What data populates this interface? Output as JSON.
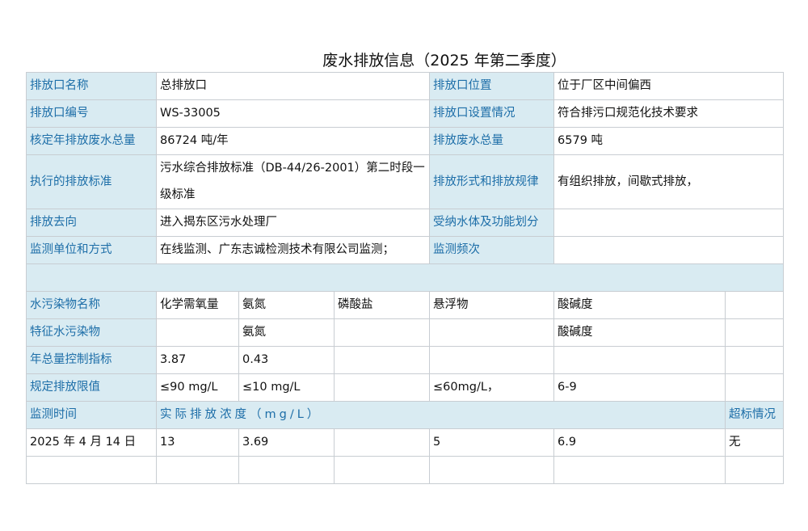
{
  "title": "废水排放信息（2025 年第二季度）",
  "info": {
    "outlet_name_label": "排放口名称",
    "outlet_name": "总排放口",
    "outlet_location_label": "排放口位置",
    "outlet_location": "位于厂区中间偏西",
    "outlet_code_label": "排放口编号",
    "outlet_code": "WS-33005",
    "outlet_setup_label": "排放口设置情况",
    "outlet_setup": "符合排污口规范化技术要求",
    "annual_total_label": "核定年排放废水总量",
    "annual_total": "86724 吨/年",
    "discharge_total_label": "排放废水总量",
    "discharge_total": "6579 吨",
    "standard_label": "执行的排放标准",
    "standard": "污水综合排放标准（DB-44/26-2001）第二时段一级标准",
    "discharge_form_label": "排放形式和排放规律",
    "discharge_form": "有组织排放，间歇式排放，",
    "destination_label": "排放去向",
    "destination": "进入揭东区污水处理厂",
    "receiving_label": "受纳水体及功能划分",
    "receiving": "",
    "monitor_unit_label": "监测单位和方式",
    "monitor_unit": "在线监测、广东志诚检测技术有限公司监测；",
    "monitor_freq_label": "监测频次",
    "monitor_freq": ""
  },
  "pollutants": {
    "name_label": "水污染物名称",
    "names": [
      "化学需氧量",
      "氨氮",
      "磷酸盐",
      "悬浮物",
      "酸碱度",
      ""
    ],
    "feature_label": "特征水污染物",
    "features": [
      "",
      "氨氮",
      "",
      "",
      "酸碱度",
      ""
    ],
    "control_label": "年总量控制指标",
    "controls": [
      "3.87",
      "0.43",
      "",
      "",
      "",
      ""
    ],
    "limit_label": "规定排放限值",
    "limits": [
      "≤90 mg/L",
      "≤10 mg/L",
      "",
      "≤60mg/L，",
      "6-9",
      ""
    ]
  },
  "monitoring": {
    "time_label": "监测时间",
    "concentration_label": "实际排放浓度（mg/L）",
    "exceed_label": "超标情况",
    "rows": [
      {
        "time": "2025 年 4 月 14 日",
        "values": [
          "13",
          "3.69",
          "",
          "5",
          "6.9"
        ],
        "exceed": "无"
      },
      {
        "time": "",
        "values": [
          "",
          "",
          "",
          "",
          ""
        ],
        "exceed": ""
      }
    ]
  }
}
